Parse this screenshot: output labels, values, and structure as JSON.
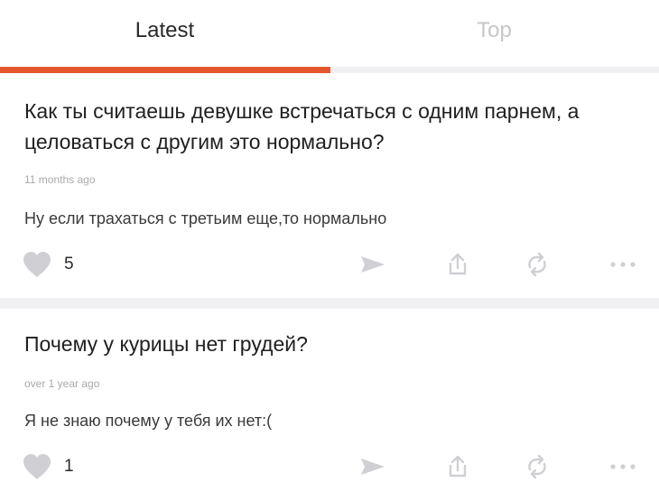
{
  "colors": {
    "accent": "#e4572e",
    "icon_gray": "#cfcfd4"
  },
  "tabs": [
    {
      "label": "Latest",
      "active": true
    },
    {
      "label": "Top",
      "active": false
    }
  ],
  "posts": [
    {
      "question": "Как ты считаешь девушке встречаться с одним парнем, а целоваться с другим это нормально?",
      "time": "11 months ago",
      "answer": "Ну если трахаться с третьим еще,то нормально",
      "likes": "5"
    },
    {
      "question": "Почему у курицы нет грудей?",
      "time": "over 1 year ago",
      "answer": "Я не знаю почему у тебя их нет:(",
      "likes": "1"
    }
  ],
  "icons": {
    "like": "heart-icon",
    "send": "send-icon",
    "share": "share-icon",
    "repost": "repost-icon",
    "more": "more-icon"
  }
}
